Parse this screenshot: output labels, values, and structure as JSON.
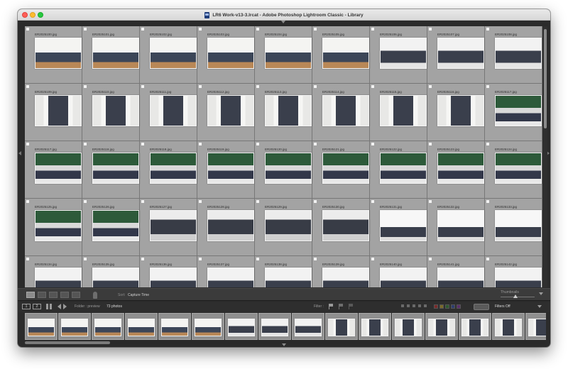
{
  "window": {
    "title": "LR6 Work-v13-3.lrcat - Adobe Photoshop Lightroom Classic - Library"
  },
  "grid": {
    "cells": [
      {
        "label": "ER2025100.jpg",
        "scene": "a"
      },
      {
        "label": "ER2025101.jpg",
        "scene": "a"
      },
      {
        "label": "ER2025102.jpg",
        "scene": "a"
      },
      {
        "label": "ER2025103.jpg",
        "scene": "a"
      },
      {
        "label": "ER2025104.jpg",
        "scene": "a"
      },
      {
        "label": "ER2025105.jpg",
        "scene": "a"
      },
      {
        "label": "ER2025106.jpg",
        "scene": "b"
      },
      {
        "label": "ER2025107.jpg",
        "scene": "b"
      },
      {
        "label": "ER2025108.jpg",
        "scene": "b"
      },
      {
        "label": "ER2025109.jpg",
        "scene": "c"
      },
      {
        "label": "ER2025110.jpg",
        "scene": "c"
      },
      {
        "label": "ER2025111.jpg",
        "scene": "c"
      },
      {
        "label": "ER2025112.jpg",
        "scene": "c"
      },
      {
        "label": "ER2025113.jpg",
        "scene": "c"
      },
      {
        "label": "ER2025114.jpg",
        "scene": "c"
      },
      {
        "label": "ER2025115.jpg",
        "scene": "c"
      },
      {
        "label": "ER2025116.jpg",
        "scene": "c"
      },
      {
        "label": "ER2025117.jpg",
        "scene": "d"
      },
      {
        "label": "ER2025117.jpg",
        "scene": "d"
      },
      {
        "label": "ER2025118.jpg",
        "scene": "d"
      },
      {
        "label": "ER2025118.jpg",
        "scene": "d"
      },
      {
        "label": "ER2025119.jpg",
        "scene": "d"
      },
      {
        "label": "ER2025120.jpg",
        "scene": "d"
      },
      {
        "label": "ER2025121.jpg",
        "scene": "d"
      },
      {
        "label": "ER2025122.jpg",
        "scene": "d"
      },
      {
        "label": "ER2025123.jpg",
        "scene": "d"
      },
      {
        "label": "ER2025124.jpg",
        "scene": "d"
      },
      {
        "label": "ER2025125.jpg",
        "scene": "d"
      },
      {
        "label": "ER2025126.jpg",
        "scene": "d"
      },
      {
        "label": "ER2025127.jpg",
        "scene": "e"
      },
      {
        "label": "ER2025128.jpg",
        "scene": "e"
      },
      {
        "label": "ER2025129.jpg",
        "scene": "e"
      },
      {
        "label": "ER2025130.jpg",
        "scene": "e"
      },
      {
        "label": "ER2025131.jpg",
        "scene": "f"
      },
      {
        "label": "ER2025132.jpg",
        "scene": "f"
      },
      {
        "label": "ER2025133.jpg",
        "scene": "f"
      },
      {
        "label": "ER2025134.jpg",
        "scene": "b"
      },
      {
        "label": "ER2025135.jpg",
        "scene": "b"
      },
      {
        "label": "ER2025136.jpg",
        "scene": "b"
      },
      {
        "label": "ER2025137.jpg",
        "scene": "b"
      },
      {
        "label": "ER2025138.jpg",
        "scene": "b"
      },
      {
        "label": "ER2025139.jpg",
        "scene": "b"
      },
      {
        "label": "ER2025140.jpg",
        "scene": "b"
      },
      {
        "label": "ER2025141.jpg",
        "scene": "b"
      },
      {
        "label": "ER2025142.jpg",
        "scene": "b"
      }
    ]
  },
  "toolbar": {
    "sort_label": "Sort:",
    "sort_value": "Capture Time",
    "thumbnails_label": "Thumbnails"
  },
  "filmstrip_bar": {
    "screen_1": "1",
    "screen_2": "2",
    "source": "Folder : preview",
    "count": "73 photos",
    "filter_label": "Filter :",
    "filters_off": "Filters Off"
  },
  "filmstrip": {
    "scenes": [
      "a",
      "a",
      "a",
      "a",
      "a",
      "a",
      "b",
      "b",
      "b",
      "c",
      "c",
      "c",
      "c",
      "c",
      "c",
      "c",
      "c"
    ]
  },
  "colors": {
    "grid_bg": "#686868",
    "cell_bg": "#a3a3a3",
    "chrome": "#2b2b2b"
  },
  "icons": {
    "grid_view": "grid-view-icon",
    "loupe_view": "loupe-view-icon",
    "compare_view": "compare-view-icon",
    "survey_view": "survey-view-icon",
    "people_view": "people-view-icon",
    "painter": "painter-icon",
    "flag": "flag-icon"
  }
}
